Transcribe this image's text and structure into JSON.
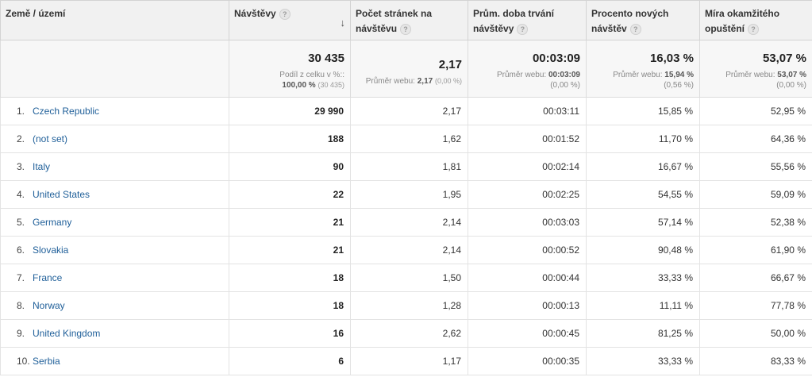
{
  "headers": {
    "country": "Země / území",
    "visits": "Návštěvy",
    "pages_per_visit_l1": "Počet stránek na",
    "pages_per_visit_l2": "návštěvu",
    "avg_duration_l1": "Prům. doba trvání",
    "avg_duration_l2": "návštěvy",
    "new_visits_l1": "Procento nových",
    "new_visits_l2": "návštěv",
    "bounce_l1": "Míra okamžitého",
    "bounce_l2": "opuštění",
    "help_glyph": "?",
    "sort_glyph": "↓"
  },
  "totals": {
    "visits": "30 435",
    "visits_sub_l1": "Podíl z celku v %::",
    "visits_sub_l2_pct": "100,00 %",
    "visits_sub_l2_abs": "(30 435)",
    "pages_per_visit": "2,17",
    "pages_sub_label": "Průměr webu:",
    "pages_sub_value": "2,17",
    "pages_sub_delta": "(0,00 %)",
    "avg_duration": "00:03:09",
    "duration_sub_label": "Průměr webu:",
    "duration_sub_value": "00:03:09",
    "duration_sub_delta": "(0,00 %)",
    "new_visits": "16,03 %",
    "new_sub_label": "Průměr webu:",
    "new_sub_value": "15,94 %",
    "new_sub_delta": "(0,56 %)",
    "bounce": "53,07 %",
    "bounce_sub_label": "Průměr webu:",
    "bounce_sub_value": "53,07 %",
    "bounce_sub_delta": "(0,00 %)"
  },
  "rows": [
    {
      "rank": "1.",
      "country": "Czech Republic",
      "visits": "29 990",
      "pages": "2,17",
      "duration": "00:03:11",
      "new": "15,85 %",
      "bounce": "52,95 %"
    },
    {
      "rank": "2.",
      "country": "(not set)",
      "visits": "188",
      "pages": "1,62",
      "duration": "00:01:52",
      "new": "11,70 %",
      "bounce": "64,36 %"
    },
    {
      "rank": "3.",
      "country": "Italy",
      "visits": "90",
      "pages": "1,81",
      "duration": "00:02:14",
      "new": "16,67 %",
      "bounce": "55,56 %"
    },
    {
      "rank": "4.",
      "country": "United States",
      "visits": "22",
      "pages": "1,95",
      "duration": "00:02:25",
      "new": "54,55 %",
      "bounce": "59,09 %"
    },
    {
      "rank": "5.",
      "country": "Germany",
      "visits": "21",
      "pages": "2,14",
      "duration": "00:03:03",
      "new": "57,14 %",
      "bounce": "52,38 %"
    },
    {
      "rank": "6.",
      "country": "Slovakia",
      "visits": "21",
      "pages": "2,14",
      "duration": "00:00:52",
      "new": "90,48 %",
      "bounce": "61,90 %"
    },
    {
      "rank": "7.",
      "country": "France",
      "visits": "18",
      "pages": "1,50",
      "duration": "00:00:44",
      "new": "33,33 %",
      "bounce": "66,67 %"
    },
    {
      "rank": "8.",
      "country": "Norway",
      "visits": "18",
      "pages": "1,28",
      "duration": "00:00:13",
      "new": "11,11 %",
      "bounce": "77,78 %"
    },
    {
      "rank": "9.",
      "country": "United Kingdom",
      "visits": "16",
      "pages": "2,62",
      "duration": "00:00:45",
      "new": "81,25 %",
      "bounce": "50,00 %"
    },
    {
      "rank": "10.",
      "country": "Serbia",
      "visits": "6",
      "pages": "1,17",
      "duration": "00:00:35",
      "new": "33,33 %",
      "bounce": "83,33 %"
    }
  ]
}
